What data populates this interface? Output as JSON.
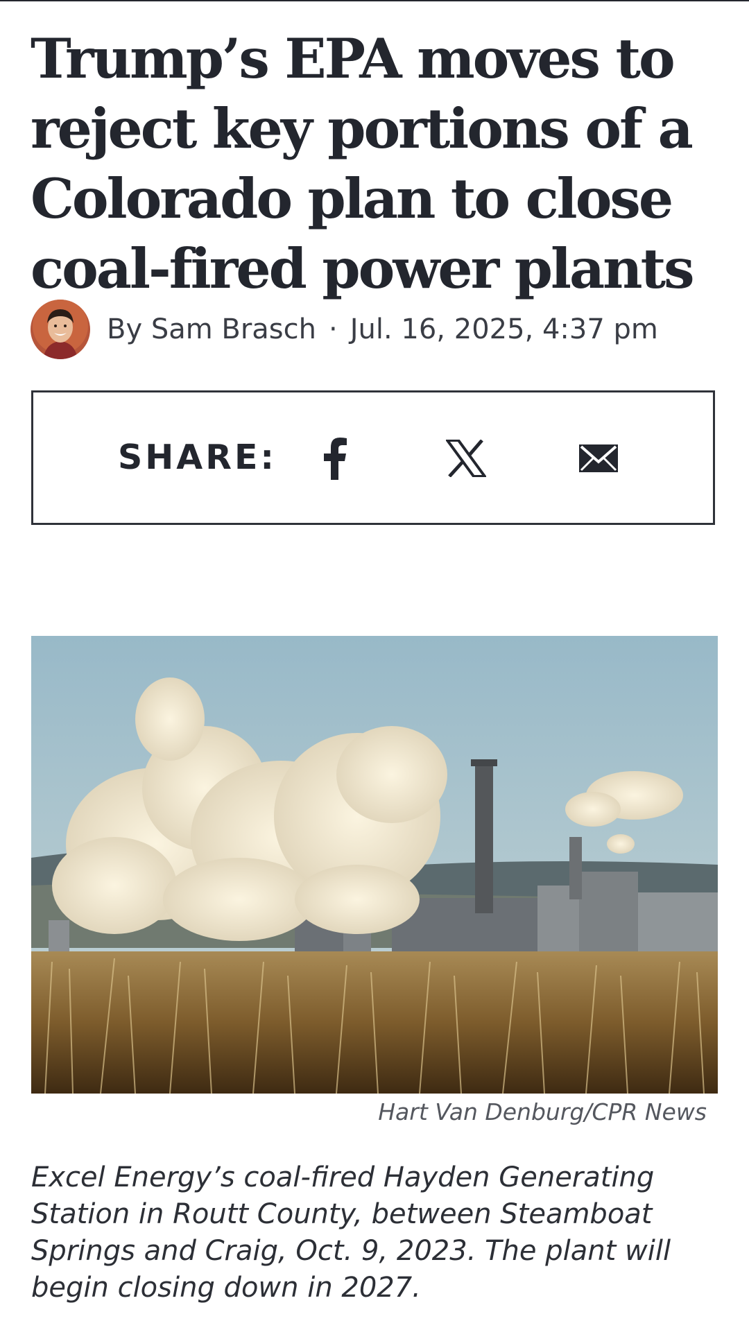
{
  "article": {
    "headline": "Trump’s EPA moves to reject key portions of a Colorado plan to close coal-fired power plants",
    "byline": {
      "author": "By Sam Brasch",
      "separator": "·",
      "timestamp": "Jul. 16, 2025, 4:37 pm"
    }
  },
  "share": {
    "label": "SHARE:",
    "buttons": [
      {
        "name": "facebook",
        "icon": "facebook-icon"
      },
      {
        "name": "x",
        "icon": "x-icon"
      },
      {
        "name": "email",
        "icon": "mail-icon"
      }
    ]
  },
  "hero": {
    "credit": "Hart Van Denburg/CPR News",
    "caption": "Excel Energy’s coal-fired Hayden Generating Station in Routt County, between Steamboat Springs and Craig, Oct. 9, 2023. The plant will begin closing down in 2027."
  },
  "colors": {
    "text": "#23262e",
    "border": "#2f3239",
    "sky": "#a9c3cf",
    "grass": "#8a6a3a"
  }
}
